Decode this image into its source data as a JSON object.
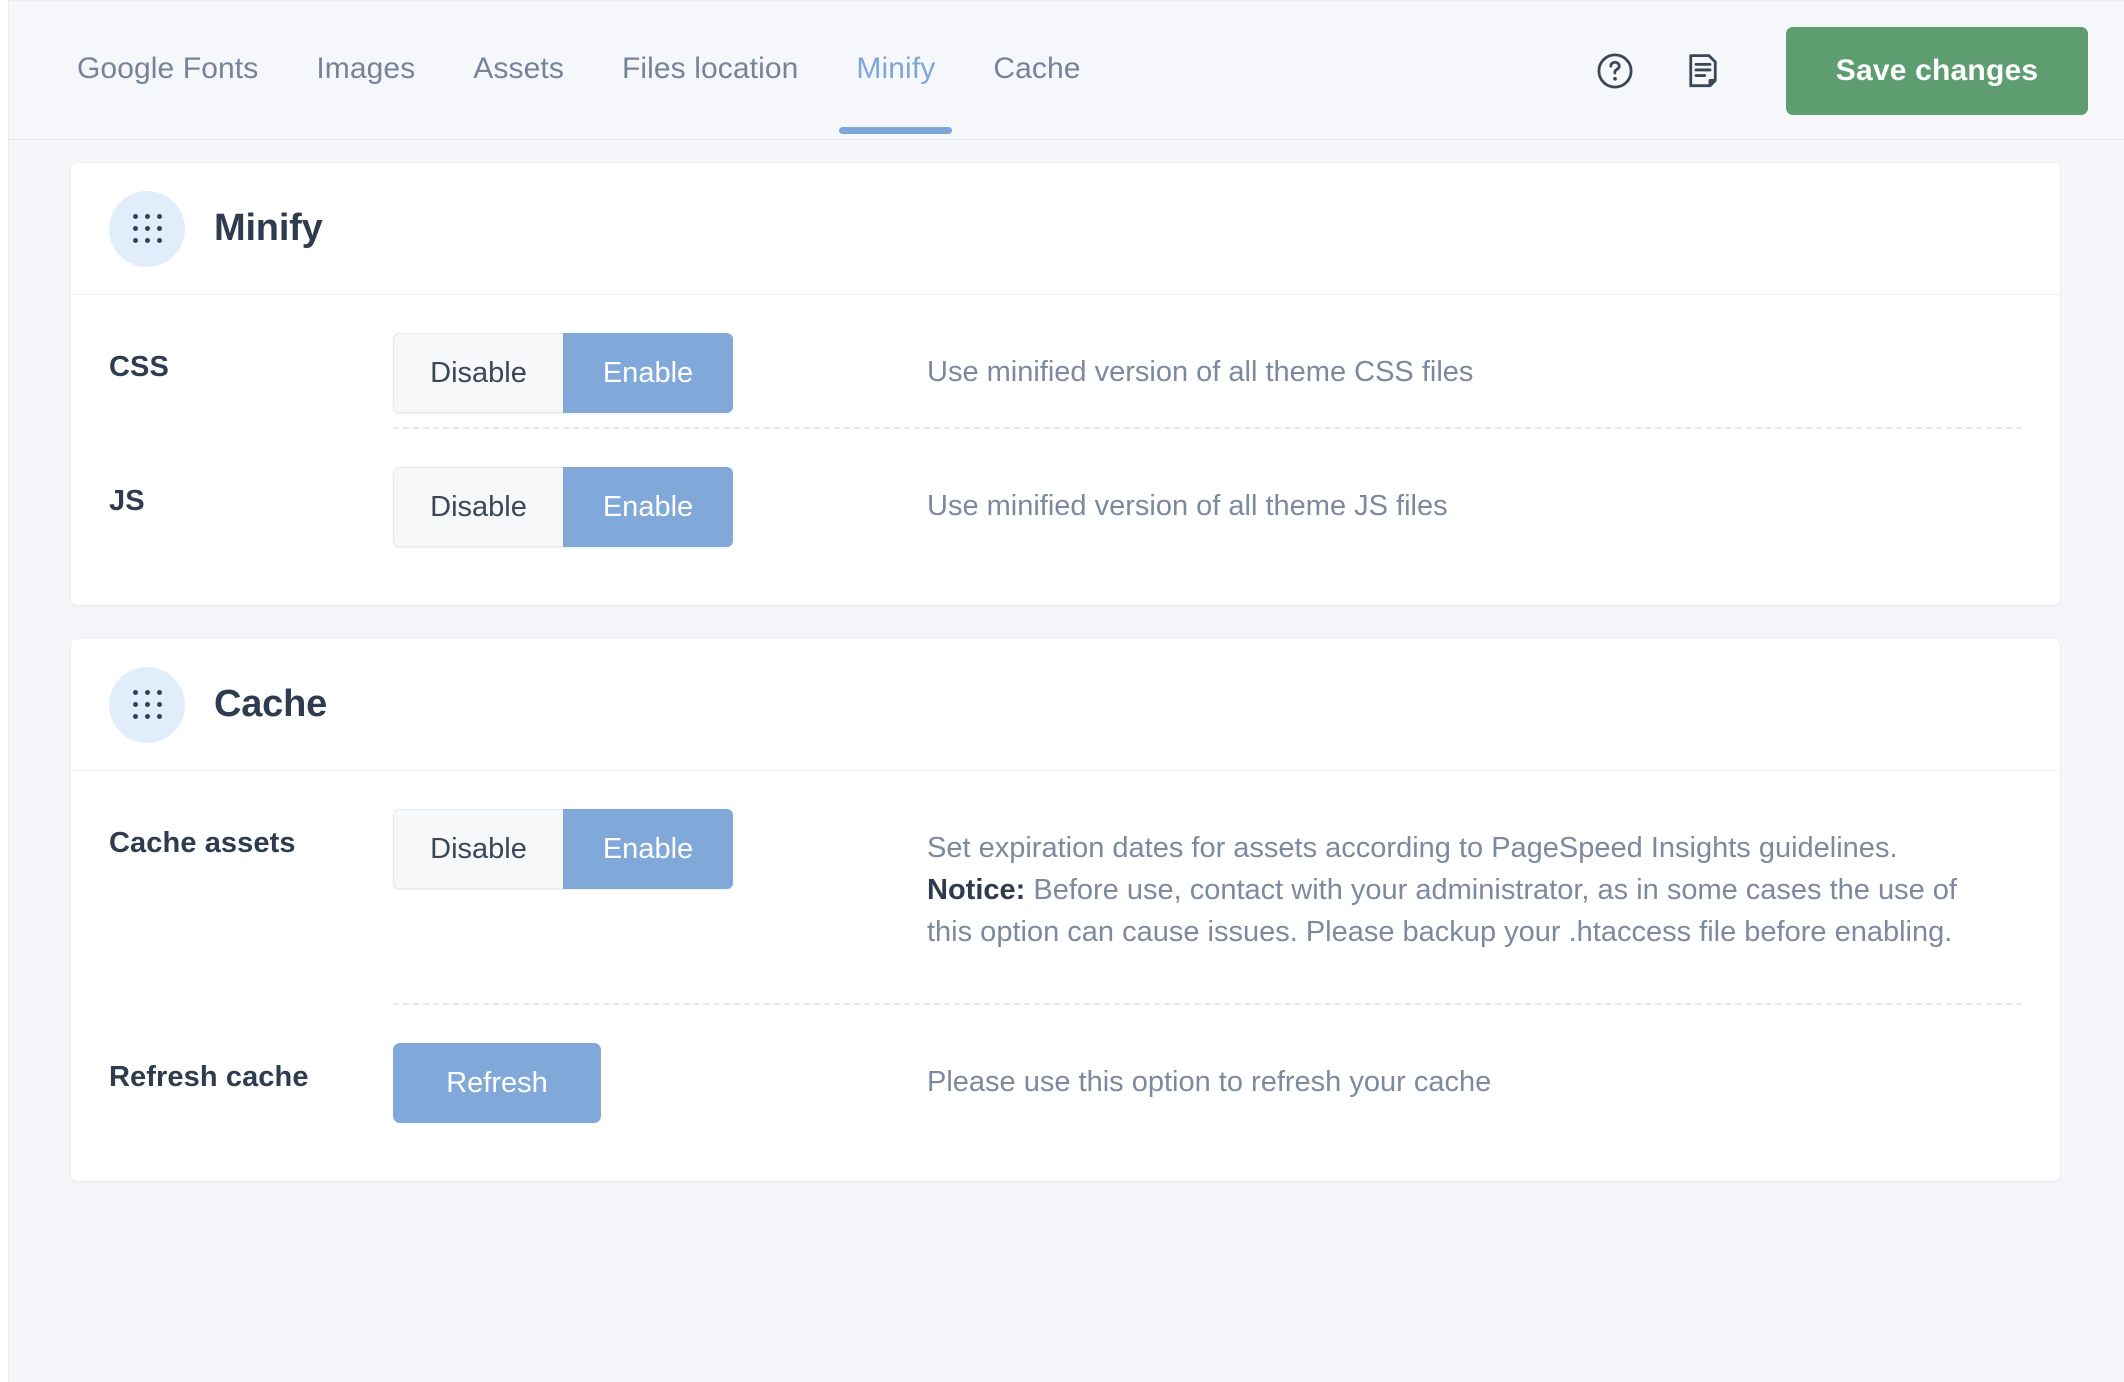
{
  "topbar": {
    "tabs": [
      {
        "label": "Google Fonts",
        "active": false
      },
      {
        "label": "Images",
        "active": false
      },
      {
        "label": "Assets",
        "active": false
      },
      {
        "label": "Files location",
        "active": false
      },
      {
        "label": "Minify",
        "active": true
      },
      {
        "label": "Cache",
        "active": false
      }
    ],
    "help_icon": "question-circle-icon",
    "notes_icon": "document-note-icon",
    "save_label": "Save changes",
    "accent_green": "#5e9d70",
    "accent_blue": "#7fa6da"
  },
  "sections": [
    {
      "title": "Minify",
      "icon": "dot-grid-icon",
      "rows": [
        {
          "label": "CSS",
          "control": "toggle",
          "options": {
            "off": "Disable",
            "on": "Enable"
          },
          "selected": "Enable",
          "description": "Use minified version of all theme CSS files"
        },
        {
          "label": "JS",
          "control": "toggle",
          "options": {
            "off": "Disable",
            "on": "Enable"
          },
          "selected": "Enable",
          "description": "Use minified version of all theme JS files"
        }
      ]
    },
    {
      "title": "Cache",
      "icon": "dot-grid-icon",
      "rows": [
        {
          "label": "Cache assets",
          "control": "toggle",
          "options": {
            "off": "Disable",
            "on": "Enable"
          },
          "selected": "Enable",
          "description_line1": "Set expiration dates for assets according to PageSpeed Insights guidelines.",
          "notice_label": "Notice:",
          "description_line2": "Before use, contact with your administrator, as in some cases the use of this option can cause issues. Please backup your .htaccess file before enabling."
        },
        {
          "label": "Refresh cache",
          "control": "button",
          "button_label": "Refresh",
          "description": "Please use this option to refresh your cache"
        }
      ]
    }
  ]
}
